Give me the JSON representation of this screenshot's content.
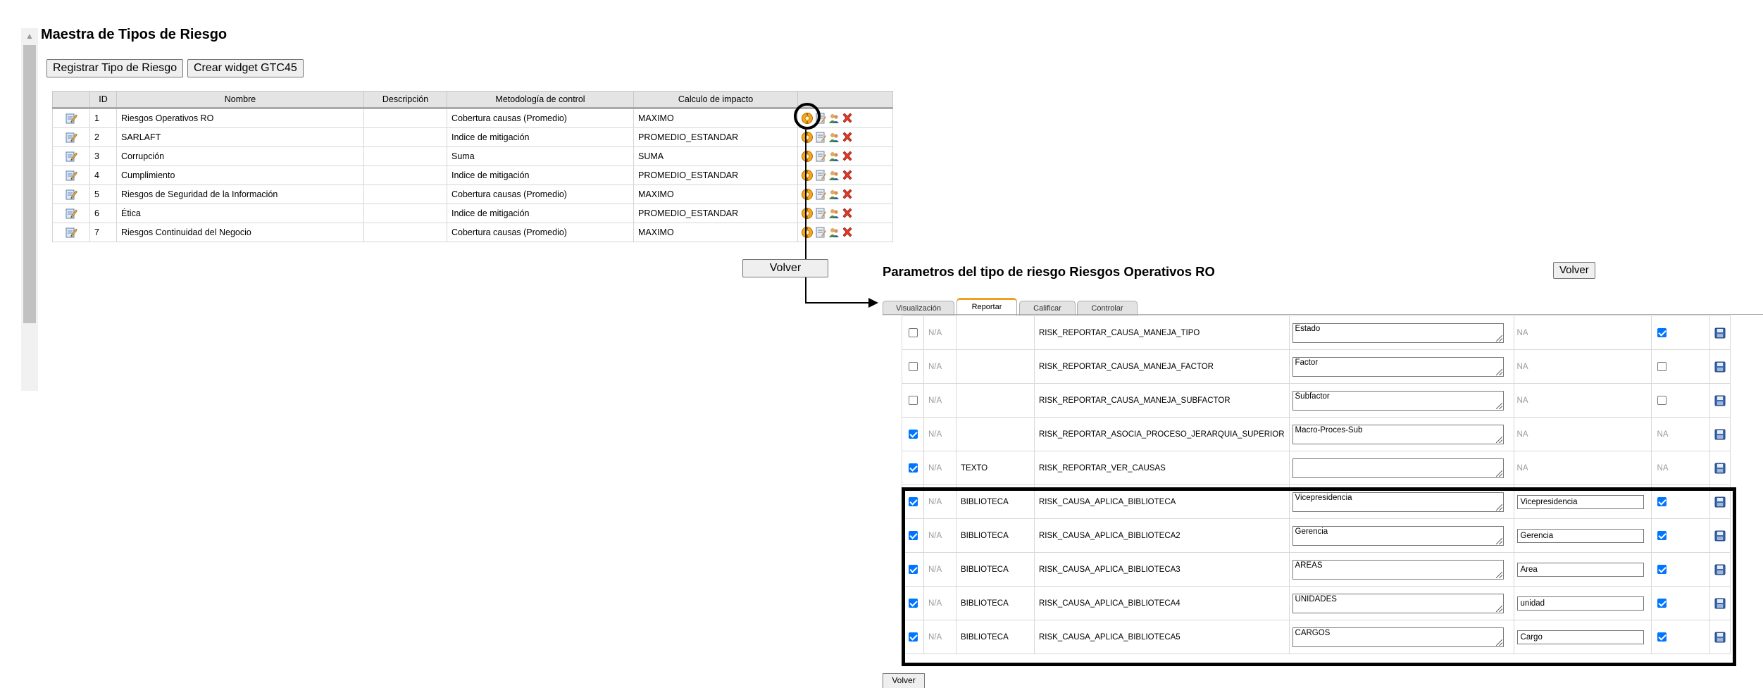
{
  "master": {
    "title": "Maestra de Tipos de Riesgo",
    "register_button": "Registrar Tipo de Riesgo",
    "widget_button": "Crear widget GTC45",
    "back_button": "Volver",
    "columns": [
      "",
      "ID",
      "Nombre",
      "Descripción",
      "Metodología de control",
      "Calculo de impacto",
      ""
    ],
    "rows": [
      {
        "id": "1",
        "nombre": "Riesgos Operativos RO",
        "descripcion": "",
        "metodologia": "Cobertura causas (Promedio)",
        "calculo": "MAXIMO"
      },
      {
        "id": "2",
        "nombre": "SARLAFT",
        "descripcion": "",
        "metodologia": "Indice de mitigación",
        "calculo": "PROMEDIO_ESTANDAR"
      },
      {
        "id": "3",
        "nombre": "Corrupción",
        "descripcion": "",
        "metodologia": "Suma",
        "calculo": "SUMA"
      },
      {
        "id": "4",
        "nombre": "Cumplimiento",
        "descripcion": "",
        "metodologia": "Indice de mitigación",
        "calculo": "PROMEDIO_ESTANDAR"
      },
      {
        "id": "5",
        "nombre": "Riesgos de Seguridad de la Información",
        "descripcion": "",
        "metodologia": "Cobertura causas (Promedio)",
        "calculo": "MAXIMO"
      },
      {
        "id": "6",
        "nombre": "Ética",
        "descripcion": "",
        "metodologia": "Indice de mitigación",
        "calculo": "PROMEDIO_ESTANDAR"
      },
      {
        "id": "7",
        "nombre": "Riesgos Continuidad del Negocio",
        "descripcion": "",
        "metodologia": "Cobertura causas (Promedio)",
        "calculo": "MAXIMO"
      }
    ]
  },
  "params": {
    "title": "Parametros del tipo de riesgo Riesgos Operativos RO",
    "back_button": "Volver",
    "bottom_button": "Volver",
    "tabs": [
      "Visualización",
      "Reportar",
      "Calificar",
      "Controlar"
    ],
    "active_tab": "Reportar",
    "rows": [
      {
        "checked": false,
        "na": "N/A",
        "tipo": "",
        "clave": "RISK_REPORTAR_CAUSA_MANEJA_TIPO",
        "texto": "Estado",
        "valor": "NA",
        "valor_is_input": false,
        "visible": true
      },
      {
        "checked": false,
        "na": "N/A",
        "tipo": "",
        "clave": "RISK_REPORTAR_CAUSA_MANEJA_FACTOR",
        "texto": "Factor",
        "valor": "NA",
        "valor_is_input": false,
        "visible": false
      },
      {
        "checked": false,
        "na": "N/A",
        "tipo": "",
        "clave": "RISK_REPORTAR_CAUSA_MANEJA_SUBFACTOR",
        "texto": "Subfactor",
        "valor": "NA",
        "valor_is_input": false,
        "visible": false
      },
      {
        "checked": true,
        "na": "N/A",
        "tipo": "",
        "clave": "RISK_REPORTAR_ASOCIA_PROCESO_JERARQUIA_SUPERIOR",
        "texto": "Macro-Proces-Sub",
        "valor": "NA",
        "valor_is_input": false,
        "visible": null,
        "visible_text": "NA"
      },
      {
        "checked": true,
        "na": "N/A",
        "tipo": "TEXTO",
        "clave": "RISK_REPORTAR_VER_CAUSAS",
        "texto": "",
        "valor": "NA",
        "valor_is_input": false,
        "visible": null,
        "visible_text": "NA"
      },
      {
        "checked": true,
        "na": "N/A",
        "tipo": "BIBLIOTECA",
        "clave": "RISK_CAUSA_APLICA_BIBLIOTECA",
        "texto": "Vicepresidencia",
        "valor": "Vicepresidencia",
        "valor_is_input": true,
        "visible": true
      },
      {
        "checked": true,
        "na": "N/A",
        "tipo": "BIBLIOTECA",
        "clave": "RISK_CAUSA_APLICA_BIBLIOTECA2",
        "texto": "Gerencia",
        "valor": "Gerencia",
        "valor_is_input": true,
        "visible": true
      },
      {
        "checked": true,
        "na": "N/A",
        "tipo": "BIBLIOTECA",
        "clave": "RISK_CAUSA_APLICA_BIBLIOTECA3",
        "texto": "AREAS",
        "valor": "Area",
        "valor_is_input": true,
        "visible": true
      },
      {
        "checked": true,
        "na": "N/A",
        "tipo": "BIBLIOTECA",
        "clave": "RISK_CAUSA_APLICA_BIBLIOTECA4",
        "texto": "UNIDADES",
        "valor": "unidad",
        "valor_is_input": true,
        "visible": true
      },
      {
        "checked": true,
        "na": "N/A",
        "tipo": "BIBLIOTECA",
        "clave": "RISK_CAUSA_APLICA_BIBLIOTECA5",
        "texto": "CARGOS",
        "valor": "Cargo",
        "valor_is_input": true,
        "visible": true
      }
    ]
  },
  "icons": {
    "edit": "edit-pencil-icon",
    "param": "orange-gear-icon",
    "details": "edit-form-icon",
    "people": "people-icon",
    "delete": "red-x-icon",
    "save": "floppy-disk-icon"
  },
  "colors": {
    "accent": "#0075ff",
    "tab_active": "#f0a020",
    "header_bg": "#e4e4e4"
  }
}
